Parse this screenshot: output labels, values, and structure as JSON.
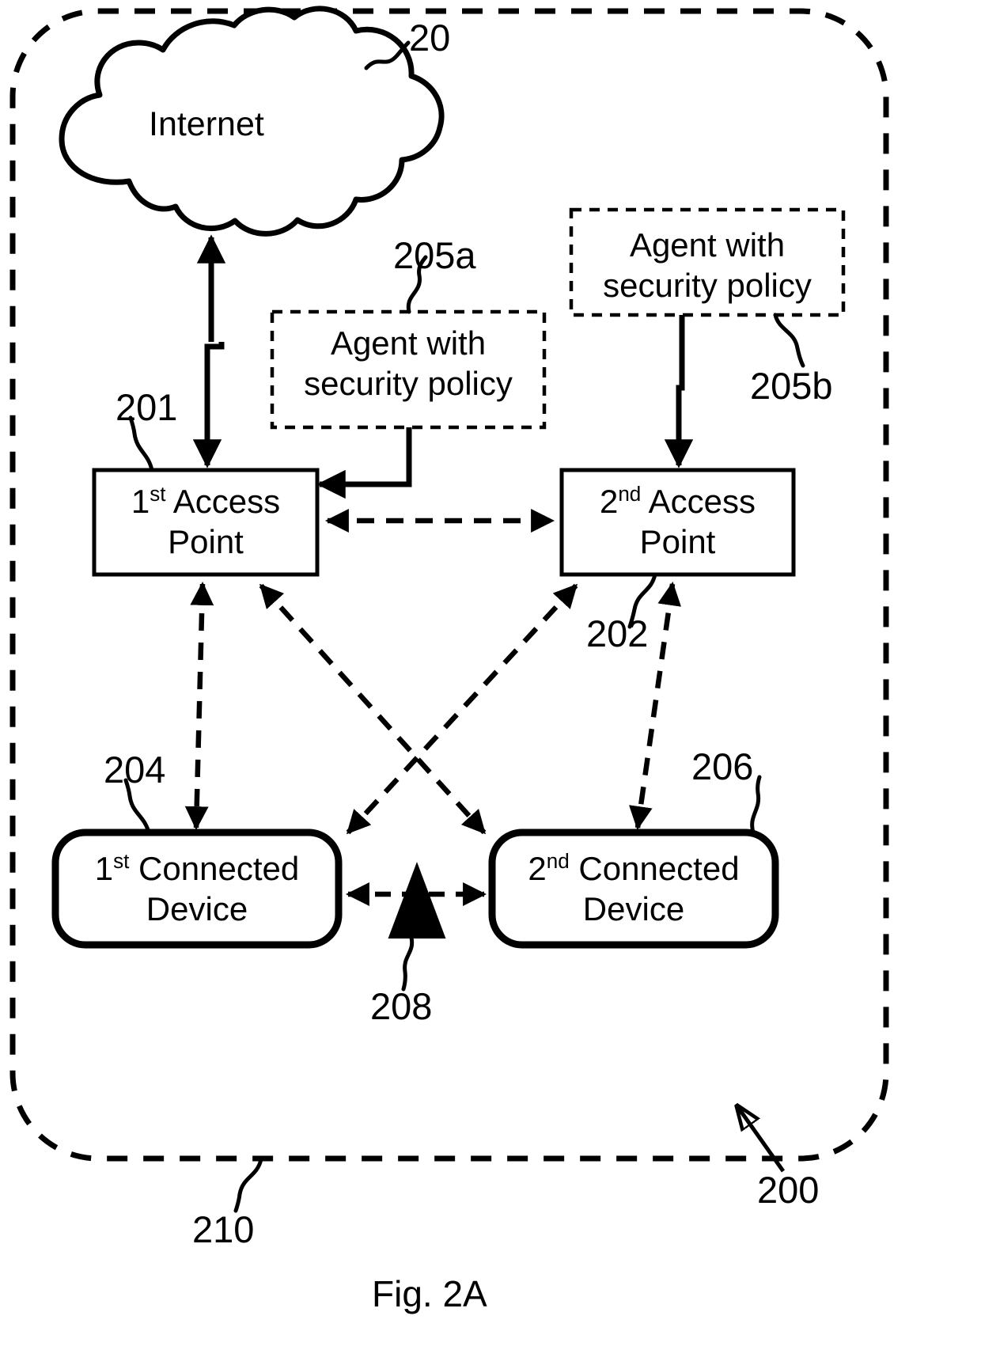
{
  "figure": {
    "caption": "Fig. 2A",
    "system_ref": "200",
    "boundary_ref": "210"
  },
  "nodes": {
    "cloud": {
      "label": "Internet",
      "ref": "20"
    },
    "access_point_1": {
      "line1_pre": "1",
      "line1_sup": "st",
      "line1_post": " Access",
      "line2": "Point",
      "ref": "201"
    },
    "access_point_2": {
      "line1_pre": "2",
      "line1_sup": "nd",
      "line1_post": " Access",
      "line2": "Point",
      "ref": "202"
    },
    "agent_a": {
      "line1": "Agent with",
      "line2": "security policy",
      "ref": "205a"
    },
    "agent_b": {
      "line1": "Agent with",
      "line2": "security policy",
      "ref": "205b"
    },
    "device_1": {
      "line1_pre": "1",
      "line1_sup": "st",
      "line1_post": " Connected",
      "line2": "Device",
      "ref": "204"
    },
    "device_2": {
      "line1_pre": "2",
      "line1_sup": "nd",
      "line1_post": " Connected",
      "line2": "Device",
      "ref": "206"
    },
    "interference_marker": {
      "ref": "208"
    }
  },
  "colors": {
    "stroke": "#000000",
    "background": "#ffffff"
  }
}
